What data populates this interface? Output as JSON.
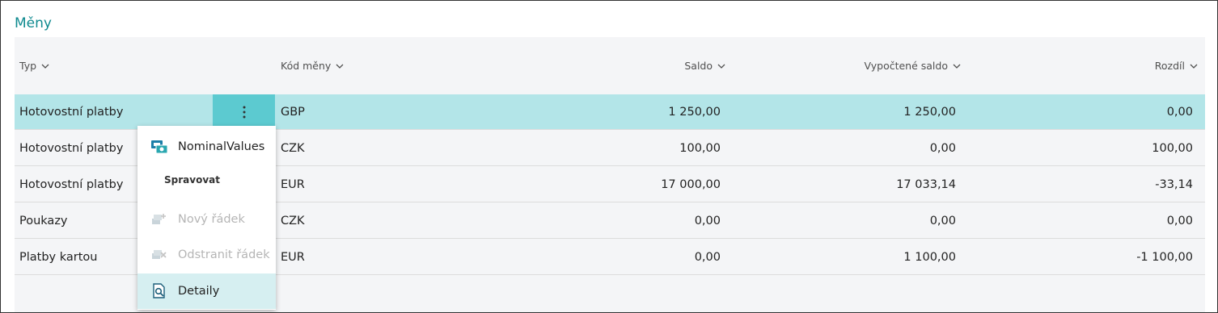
{
  "section_title": "Měny",
  "columns": {
    "typ": "Typ",
    "kod_meny": "Kód měny",
    "saldo": "Saldo",
    "vypoctene_saldo": "Vypočtené saldo",
    "rozdil": "Rozdíl"
  },
  "rows": [
    {
      "typ": "Hotovostní platby",
      "kod": "GBP",
      "saldo": "1 250,00",
      "vypoctene": "1 250,00",
      "rozdil": "0,00"
    },
    {
      "typ": "Hotovostní platby",
      "kod": "CZK",
      "saldo": "100,00",
      "vypoctene": "0,00",
      "rozdil": "100,00"
    },
    {
      "typ": "Hotovostní platby",
      "kod": "EUR",
      "saldo": "17 000,00",
      "vypoctene": "17 033,14",
      "rozdil": "-33,14"
    },
    {
      "typ": "Poukazy",
      "kod": "CZK",
      "saldo": "0,00",
      "vypoctene": "0,00",
      "rozdil": "0,00"
    },
    {
      "typ": "Platby kartou",
      "kod": "EUR",
      "saldo": "0,00",
      "vypoctene": "1 100,00",
      "rozdil": "-1 100,00"
    }
  ],
  "context_menu": {
    "nominal_values": "NominalValues",
    "section_heading": "Spravovat",
    "new_line": "Nový řádek",
    "delete_line": "Odstranit řádek",
    "details": "Detaily"
  },
  "colors": {
    "accent": "#0f8a8f",
    "selected_row": "#b3e5e8",
    "row_action": "#5ccad0"
  }
}
